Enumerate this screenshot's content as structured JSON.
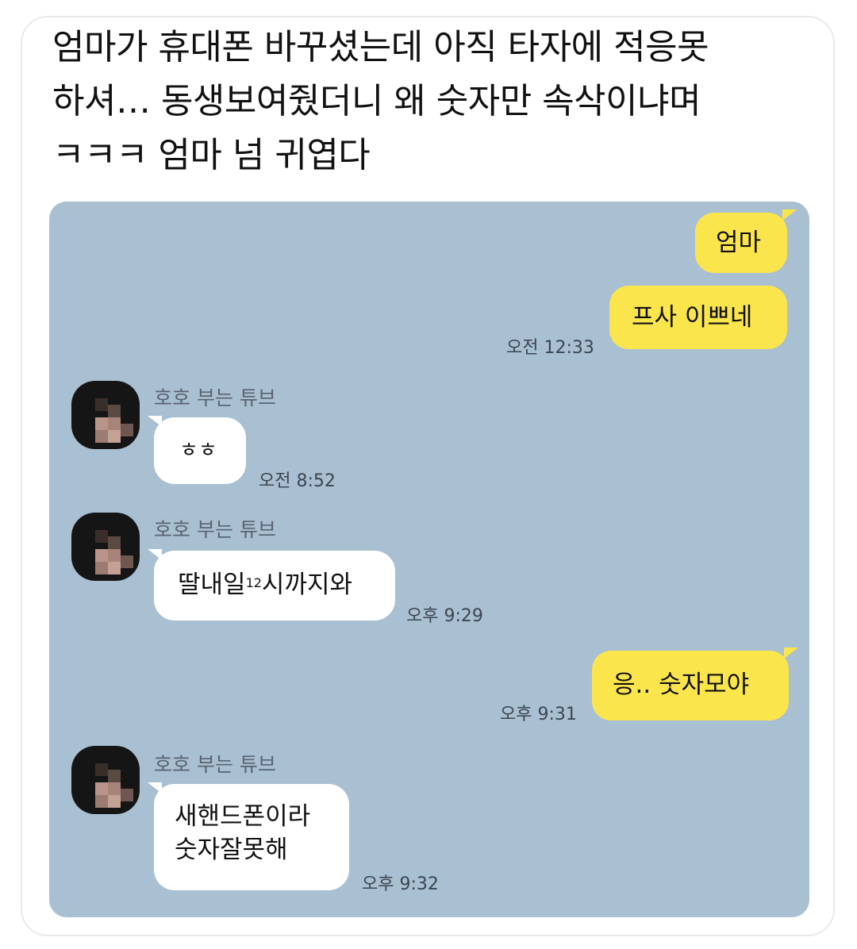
{
  "post": {
    "caption_lines": [
      "엄마가 휴대폰 바꾸셨는데 아직 타자에 적응못",
      "하셔… 동생보여줬더니 왜 숫자만 속삭이냐며",
      "ㅋㅋㅋ 엄마 넘 귀엽다"
    ]
  },
  "chat": {
    "background_color": "#a9bfd2",
    "my_bubble_color": "#fbe54d",
    "their_bubble_color": "#ffffff",
    "messages": [
      {
        "from": "me",
        "text": "엄마"
      },
      {
        "from": "me",
        "text": "프사 이쁘네",
        "time": "오전 12:33"
      },
      {
        "from": "other",
        "sender": "호호 부는 튜브",
        "text": "ㅎㅎ",
        "time": "오전 8:52"
      },
      {
        "from": "other",
        "sender": "호호 부는 튜브",
        "text_before": "딸내일",
        "text_small": "12",
        "text_after": "시까지와",
        "time": "오후 9:29"
      },
      {
        "from": "me",
        "text": "응.. 숫자모야",
        "time": "오후 9:31"
      },
      {
        "from": "other",
        "sender": "호호 부는 튜브",
        "lines": [
          "새핸드폰이라",
          "숫자잘못해"
        ],
        "time": "오후 9:32"
      }
    ]
  }
}
